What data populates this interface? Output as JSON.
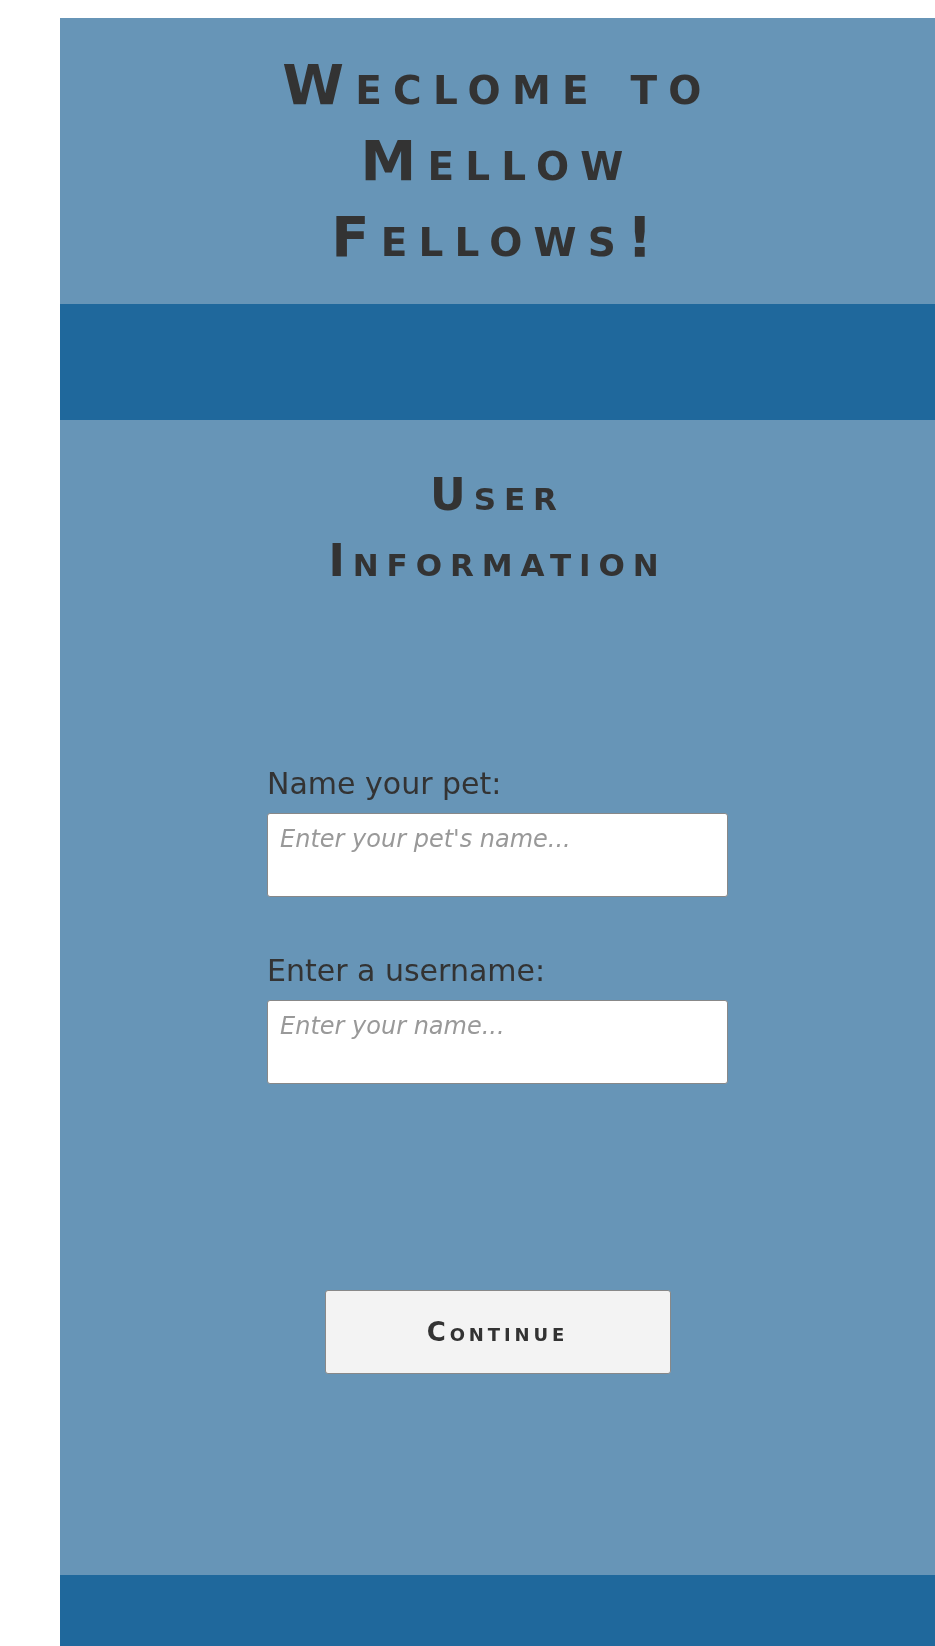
{
  "header": {
    "title": "Weclome to Mellow Fellows!"
  },
  "section": {
    "title": "User Information"
  },
  "fields": [
    {
      "label": "Name your pet:",
      "placeholder": "Enter your pet's name..."
    },
    {
      "label": "Enter a username:",
      "placeholder": "Enter your name..."
    }
  ],
  "button": {
    "label": "Continue"
  }
}
